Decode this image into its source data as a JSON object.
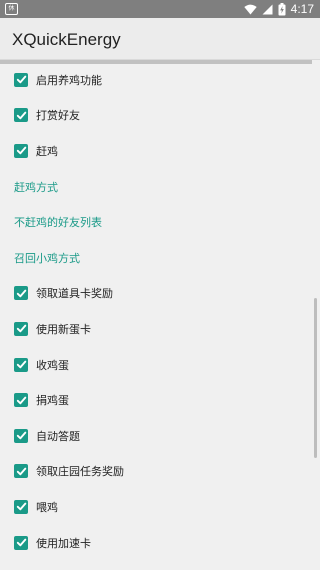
{
  "status_bar": {
    "app_icon_label": "休闲",
    "time": "4:17"
  },
  "app_bar": {
    "title": "XQuickEnergy"
  },
  "items": [
    {
      "type": "checkbox",
      "label": "启用养鸡功能",
      "checked": true
    },
    {
      "type": "checkbox",
      "label": "打赏好友",
      "checked": true
    },
    {
      "type": "checkbox",
      "label": "赶鸡",
      "checked": true
    },
    {
      "type": "category",
      "label": "赶鸡方式"
    },
    {
      "type": "category",
      "label": "不赶鸡的好友列表"
    },
    {
      "type": "category",
      "label": "召回小鸡方式"
    },
    {
      "type": "checkbox",
      "label": "领取道具卡奖励",
      "checked": true
    },
    {
      "type": "checkbox",
      "label": "使用新蛋卡",
      "checked": true
    },
    {
      "type": "checkbox",
      "label": "收鸡蛋",
      "checked": true
    },
    {
      "type": "checkbox",
      "label": "捐鸡蛋",
      "checked": true
    },
    {
      "type": "checkbox",
      "label": "自动答题",
      "checked": true
    },
    {
      "type": "checkbox",
      "label": "领取庄园任务奖励",
      "checked": true
    },
    {
      "type": "checkbox",
      "label": "喂鸡",
      "checked": true
    },
    {
      "type": "checkbox",
      "label": "使用加速卡",
      "checked": true
    }
  ],
  "colors": {
    "accent": "#1a9a88",
    "status_bar": "#7f7f7f",
    "background": "#f0f0f0"
  }
}
